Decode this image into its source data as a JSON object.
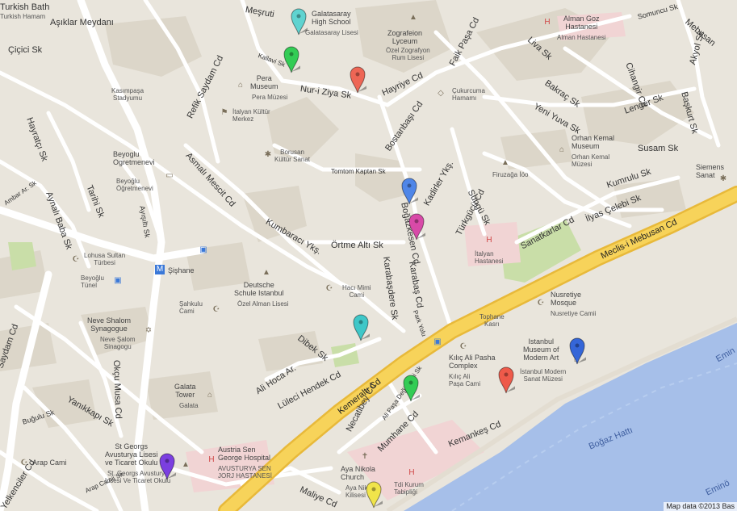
{
  "map": {
    "attribution": "Map data ©2013 Bas",
    "colors": {
      "land": "#e9e5dc",
      "block": "#dcd6c9",
      "road": "#ffffff",
      "highway": "#f7d35a",
      "highway_edge": "#e8b93a",
      "water": "#a6bfe9",
      "park": "#c9dea8",
      "hospital_area": "#f1d4d4"
    },
    "water_labels": {
      "bogaz": "Boğaz Hattı",
      "eminonu1": "Emin",
      "eminonu2": "Eminö"
    },
    "streets": {
      "kemeralti": "Kemeraltı Cd",
      "meclis": "Meclis-i Mebusan Cd",
      "refik": "Refik Saydam Cd",
      "asmali": "Asmalı Mescit Cd",
      "kumbaraci": "Kumbaracı Ykş.",
      "ortme": "Örtme Altı Sk",
      "bogazkesen": "Boğazkesen Cd",
      "karabas": "Karabaş Cd",
      "karabasdere": "Karabaşdere Sk",
      "hayriye": "Hayriye Cd",
      "nur": "Nur-i Ziya Sk",
      "bostanbasi": "Bostanbaşı Cd",
      "turkgucu": "Türkgücü Cd",
      "sungu": "Süngü Sk",
      "kadirler": "Kadirler Ykş.",
      "faik": "Faik Paşa Cd",
      "liva": "Liva Sk",
      "bakrac": "Bakraç Sk",
      "yeniyuva": "Yeni Yuva Sk",
      "lenger": "Lenger Sk",
      "susam": "Susam Sk",
      "kumrulu": "Kumrulu Sk",
      "ilyas": "İlyas Çelebi Sk",
      "sanatkarlar": "Sanatkarlar Cd",
      "chihangir": "Cihangir Cd",
      "akyol": "Akyol Sk",
      "baskurt": "Başkurt Sk",
      "mebusan": "Mebusan",
      "somuncu": "Somuncu Sk",
      "necatibey": "Necatibey Cd",
      "mumhane": "Mumhane Cd",
      "alipasa": "Ali Paşa Değirmeni Sk",
      "kemankes": "Kemankeş Cd",
      "maliye": "Maliye Cd",
      "lulecihendek": "Lüleci Hendek Cd",
      "alihoca": "Ali Hoca Ar.",
      "dibek": "Dibek Sk",
      "okumusa": "Okçu Musa Cd",
      "yanikkapi": "Yanıkkapı Sk",
      "bugdulu": "Buğulu Sk",
      "yelkenciler": "Yelkenciler Cd",
      "ayniali": "Aynalı Baba Sk",
      "tarihi": "Tarihi Sk",
      "aynalicesme": "Aynalıçeşme Sk",
      "civici": "Çiçici Sk",
      "asiklar": "Aşıklar Meydanı",
      "hayrat": "Hayratçı Sk",
      "ambar": "Ambar Ar. Sk",
      "tomtom": "Tomtom Kaptan Sk",
      "kallavi": "Kallavi Sk",
      "mesrut": "Meşruti",
      "sadam": "Saydam Cd",
      "ayaspasa": "Ayışıltı Sk",
      "park": "Park Yolu",
      "arapcami": "Arap Camii Sk",
      "tarihi2": "Tarihi Sk"
    },
    "places": {
      "turkish_bath": "Turkish Bath",
      "turkish_bath2": "Turkish Hamam",
      "galatasaray": "Galatasaray\nHigh School",
      "galatasaray_tr": "Galatasaray Lisesi",
      "zografeion": "Zografeion\nLyceum",
      "zografeion_tr": "Özel Zografyon\nRum Lisesi",
      "alman": "Alman Goz\nHastanesi",
      "alman_tr": "Alman Hastanesi",
      "pera": "Pera\nMuseum",
      "pera_tr": "Pera Müzesi",
      "kasimpasa": "Kasımpaşa\nStadyumu",
      "italyan_kultur": "İtalyan Kültür\nMerkez",
      "cukurcuma": "Çukurcuma\nHamamı",
      "borusan": "Borusan\nKültür Sanat",
      "orhan": "Orhan Kemal\nMuseum",
      "orhan_tr": "Orhan Kemal\nMüzesi",
      "firuzaga": "Firuzağa İöo",
      "siemens": "Siemens\nSanat",
      "beyoglu_og": "Beyoglu\nOgretmenevi",
      "beyoglu_og_tr": "Beyoğlu\nÖğretmenevi",
      "italyan_hast": "İtalyan\nHastanesi",
      "lohusa": "Lohusa Sultan\nTürbesi",
      "sishane": "Şişhane",
      "beyoglu_tunel": "Beyoğlu\nTünel",
      "deutsche": "Deutsche\nSchule Istanbul",
      "deutsche_tr": "Özel Alman Lisesi",
      "haci_mimi": "Hacı Mimi\nCami",
      "nusretiye": "Nusretiye\nMosque",
      "nusretiye_tr": "Nusretiye Camii",
      "tophane": "Tophane\nKasrı",
      "sahkulu": "Şahkulu\nCami",
      "neve": "Neve Shalom\nSynagogue",
      "neve_tr": "Neve Şalom\nSinagogu",
      "istanbul_modern": "Istanbul\nMuseum of\nModern Art",
      "istanbul_modern_tr": "İstanbul Modern\nSanat Müzesi",
      "kilic": "Kılıç Ali Pasha\nComplex",
      "kilic_tr": "Kılıç Ali\nPaşa Cami",
      "galata": "Galata\nTower",
      "galata_tr": "Galata",
      "st_georg": "St Georgs\nAvusturya Lisesi\nve Ticaret Okulu",
      "st_georg_tr": "St. Georgs Avusturya\nLisesi Ve Ticaret Okulu",
      "austria": "Austria Sen\nGeorge Hospital",
      "austria_tr": "AVUSTURYA SEN\nJORJ HASTANESİ",
      "aya_nikola": "Aya Nikola\nChurch",
      "aya_nikola_tr": "Aya Nikola\nKilisesi",
      "tdi": "Tdi Kurum\nTabipliği",
      "arap": "Arap Cami"
    },
    "markers": [
      {
        "id": "marker-galatasaray",
        "color": "#5fd3d0"
      },
      {
        "id": "marker-kallavi",
        "color": "#33cc55"
      },
      {
        "id": "marker-nur-ziya",
        "color": "#ee6655"
      },
      {
        "id": "marker-bogazkesen-1",
        "color": "#4f86e8"
      },
      {
        "id": "marker-bogazkesen-2",
        "color": "#d84aa8"
      },
      {
        "id": "marker-lueleci",
        "color": "#3fc7c8"
      },
      {
        "id": "marker-istanbul-modern",
        "color": "#3566d8"
      },
      {
        "id": "marker-modern-red",
        "color": "#ee5a4a"
      },
      {
        "id": "marker-mumhane",
        "color": "#33cc55"
      },
      {
        "id": "marker-st-georg",
        "color": "#7b3fe0"
      },
      {
        "id": "marker-aya-nikola",
        "color": "#f0e44a"
      }
    ]
  }
}
